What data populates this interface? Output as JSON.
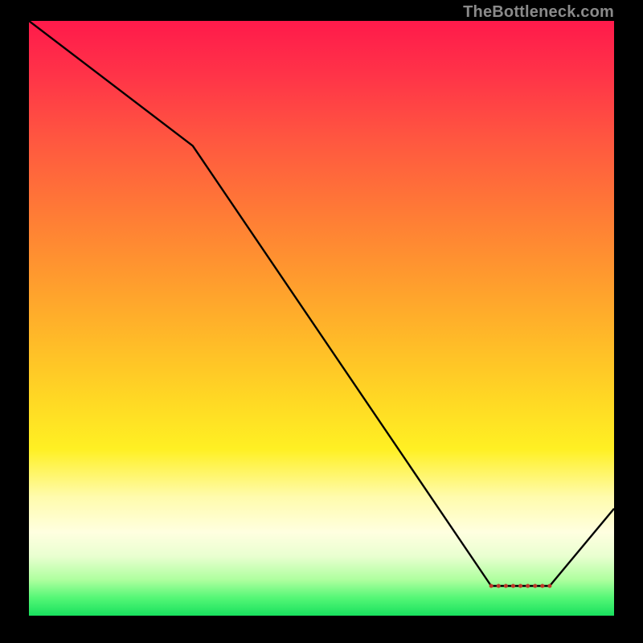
{
  "watermark": "TheBottleneck.com",
  "chart_data": {
    "type": "line",
    "title": "",
    "xlabel": "",
    "ylabel": "",
    "xlim": [
      0,
      100
    ],
    "ylim": [
      0,
      100
    ],
    "series": [
      {
        "name": "curve",
        "x": [
          0,
          28,
          79,
          89,
          100
        ],
        "values": [
          100,
          79,
          5,
          5,
          18
        ]
      }
    ],
    "optimal_band": {
      "x_start": 79,
      "x_end": 89,
      "y": 5
    },
    "gradient_stops": [
      {
        "pos": 0,
        "color": "#ff1a4b"
      },
      {
        "pos": 20,
        "color": "#ff5740"
      },
      {
        "pos": 43,
        "color": "#ff9a2e"
      },
      {
        "pos": 64,
        "color": "#ffd924"
      },
      {
        "pos": 80,
        "color": "#fffbac"
      },
      {
        "pos": 94,
        "color": "#aeff9e"
      },
      {
        "pos": 100,
        "color": "#18e05e"
      }
    ]
  }
}
